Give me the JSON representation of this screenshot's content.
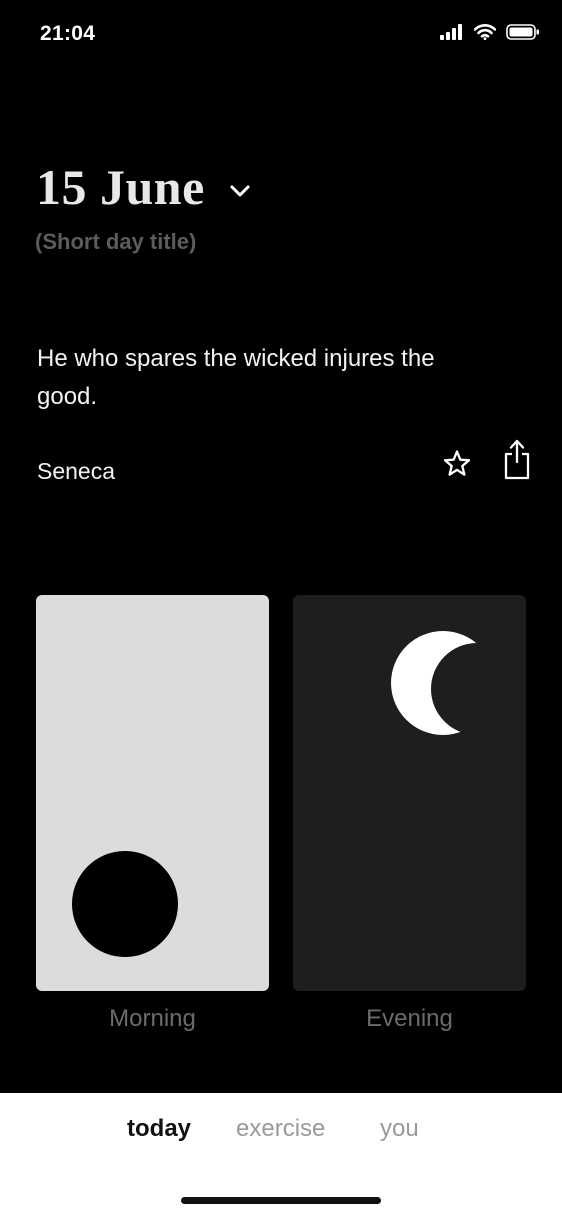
{
  "status": {
    "time": "21:04"
  },
  "header": {
    "date": "15 June",
    "subtitle": "(Short day title)"
  },
  "quote": {
    "text": "He who spares the wicked injures the good.",
    "author": "Seneca"
  },
  "icons": {
    "chevron": "chevron-down-icon",
    "favorite": "star-icon",
    "share": "share-icon",
    "signal": "cellular-signal-icon",
    "wifi": "wifi-icon",
    "battery": "battery-icon"
  },
  "cards": [
    {
      "label": "Morning",
      "icon": "sun-icon",
      "background": "#dcdcdc"
    },
    {
      "label": "Evening",
      "icon": "moon-icon",
      "background": "#1e1e1e"
    }
  ],
  "tabs": [
    {
      "label": "today",
      "active": true
    },
    {
      "label": "exercise",
      "active": false
    },
    {
      "label": "you",
      "active": false
    }
  ],
  "colors": {
    "background": "#000000",
    "tab_bar": "#ffffff",
    "muted_text": "#6b6b6b"
  }
}
